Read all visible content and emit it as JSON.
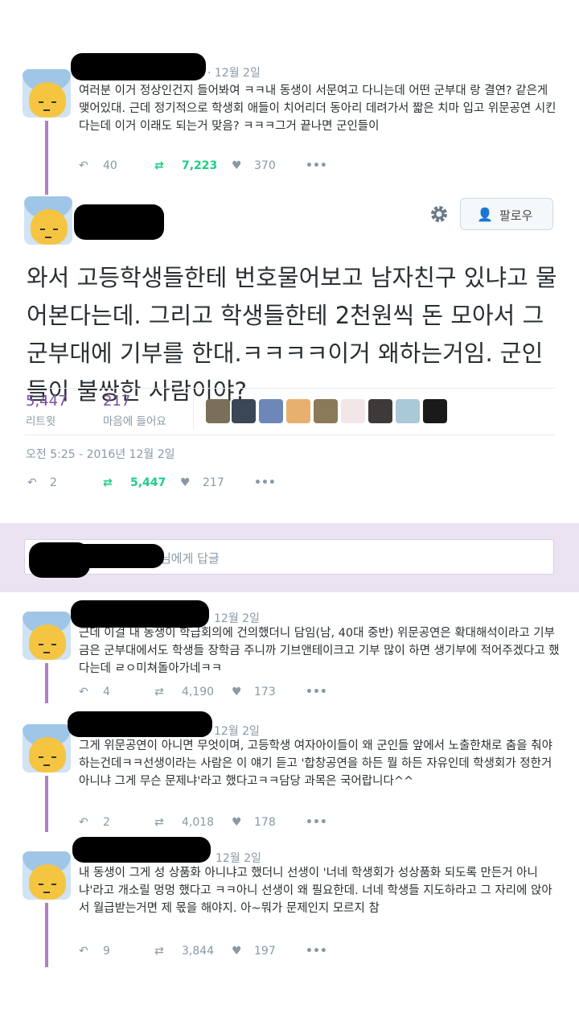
{
  "tweets": [
    {
      "date": "· 12월 2일",
      "text": "여러분 이거 정상인건지 들어봐여 ㅋㅋ내 동생이 서문여고 다니는데 어떤 군부대 랑 결연? 같은게 맺어있대. 근데 정기적으로 학생회 애들이 치어리더 동아리 데려가서 짧은 치마 입고 위문공연 시킨다는데 이거 이래도 되는거 맞음? ㅋㅋㅋ그거 끝나면 군인들이",
      "replies": "40",
      "retweets": "7,223",
      "likes": "370"
    }
  ],
  "main_tweet": {
    "follow_label": "팔로우",
    "text": "와서 고등학생들한테 번호물어보고 남자친구 있냐고 물어본다는데. 그리고 학생들한테 2천원씩 돈 모아서 그 군부대에 기부를 한대.ㅋㅋㅋㅋ이거 왜하는거임. 군인들이 불쌍한 사람이야?",
    "retweets_count": "5,447",
    "retweets_label": "리트윗",
    "likes_count": "217",
    "likes_label": "마음에 들어요",
    "timestamp": "오전 5:25 - 2016년 12월 2일",
    "replies": "2",
    "retweets": "5,447",
    "likes": "217"
  },
  "reply_box": {
    "placeholder": "님에게 답글"
  },
  "replies": [
    {
      "date": "12월 2일",
      "text": "근데 이걸 내 동생이 학급회의에 건의했더니 담임(남, 40대 중반) 위문공연은 확대해석이라고 기부금은 군부대에서도 학생들 장학금 주니까 기브앤테이크고 기부 많이 하면 생기부에 적어주겠다고 했다는데 ㄹㅇ미쳐돌아가네ㅋㅋ",
      "replies": "4",
      "retweets": "4,190",
      "likes": "173"
    },
    {
      "date": "12월 2일",
      "text": "그게 위문공연이 아니면 무엇이며, 고등학생 여자아이들이 왜 군인들 앞에서 노출한채로 춤을 춰야하는건데ㅋㅋ선생이라는 사람은 이 얘기 듣고 '합창공연을 하든 뭘 하든 자유인데 학생회가 정한거 아니냐 그게 무슨 문제냐'라고 했다고ㅋㅋ담당 과목은 국어랍니다^^",
      "replies": "2",
      "retweets": "4,018",
      "likes": "178"
    },
    {
      "date": "12월 2일",
      "text": "내 동생이 그게 성 상품화 아니냐고 했더니 선생이 '너네 학생회가 성상품화 되도록 만든거 아니냐'라고 개소릴 멍멍 했다고 ㅋㅋ아니 선생이 왜 필요한데. 너네 학생들 지도하라고 그 자리에 앉아서 월급받는거면 제 몫을 해야지. 아~뭐가 문제인지 모르지 참",
      "replies": "9",
      "retweets": "3,844",
      "likes": "197"
    }
  ],
  "colors": {
    "retweet": "#19cf86",
    "thread": "#b081c9",
    "stat": "#7b4fa8",
    "muted": "#8899a6",
    "reply_band": "#ebe3f1"
  }
}
